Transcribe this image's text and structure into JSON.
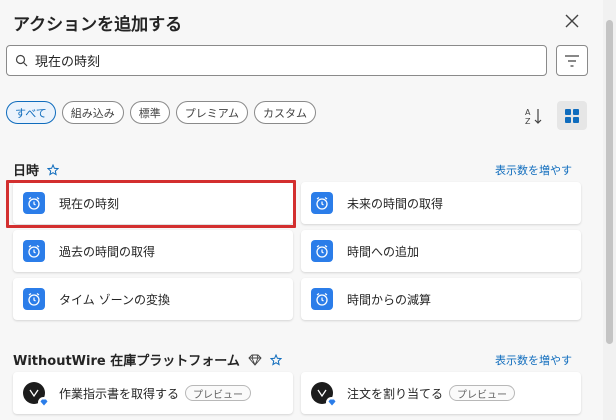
{
  "header": {
    "title": "アクションを追加する"
  },
  "search": {
    "value": "現在の時刻"
  },
  "chips": [
    {
      "label": "すべて",
      "active": true
    },
    {
      "label": "組み込み",
      "active": false
    },
    {
      "label": "標準",
      "active": false
    },
    {
      "label": "プレミアム",
      "active": false
    },
    {
      "label": "カスタム",
      "active": false
    }
  ],
  "sections": [
    {
      "title": "日時",
      "more": "表示数を増やす",
      "items": [
        {
          "label": "現在の時刻",
          "icon": "clock-icon"
        },
        {
          "label": "未来の時間の取得",
          "icon": "clock-icon"
        },
        {
          "label": "過去の時間の取得",
          "icon": "clock-icon"
        },
        {
          "label": "時間への追加",
          "icon": "clock-icon"
        },
        {
          "label": "タイム ゾーンの変換",
          "icon": "clock-icon"
        },
        {
          "label": "時間からの減算",
          "icon": "clock-icon"
        }
      ]
    },
    {
      "title": "WithoutWire 在庫プラットフォーム",
      "more": "表示数を増やす",
      "items": [
        {
          "label": "作業指示書を取得する",
          "badge": "プレビュー",
          "icon": "withoutwire-logo-icon"
        },
        {
          "label": "注文を割り当てる",
          "badge": "プレビュー",
          "icon": "withoutwire-logo-icon"
        }
      ]
    }
  ],
  "colors": {
    "accent": "#0f6cbd",
    "icon_bg": "#2b7de9",
    "highlight": "#d32f2f"
  }
}
